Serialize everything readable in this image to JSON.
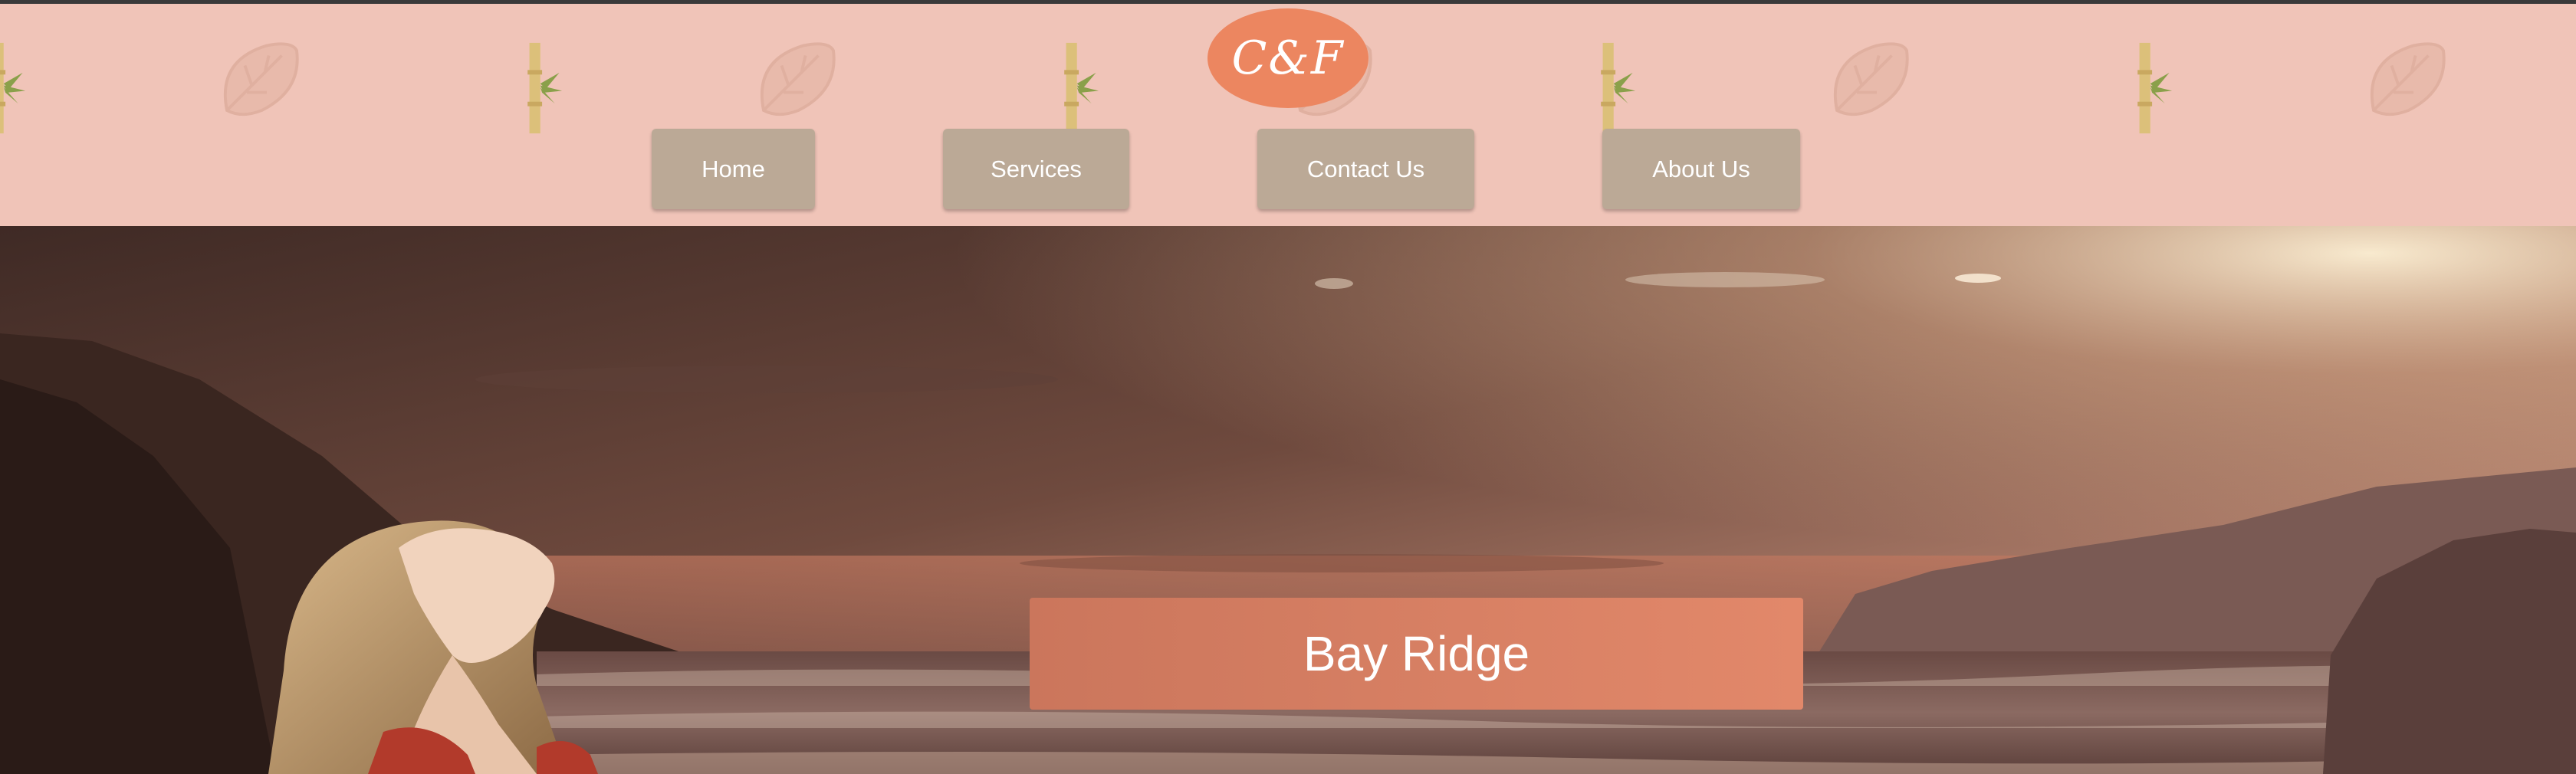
{
  "logo": {
    "text": "C&F"
  },
  "nav": {
    "items": [
      {
        "label": "Home"
      },
      {
        "label": "Services"
      },
      {
        "label": "Contact Us"
      },
      {
        "label": "About Us"
      }
    ]
  },
  "hero": {
    "title": "Bay Ridge"
  },
  "colors": {
    "header_bg": "#f0c4b8",
    "logo_bg": "#ec8660",
    "nav_button_bg": "#bba996",
    "banner_bg": "#d47c60"
  },
  "icons": [
    "leaf-icon",
    "bamboo-icon"
  ]
}
